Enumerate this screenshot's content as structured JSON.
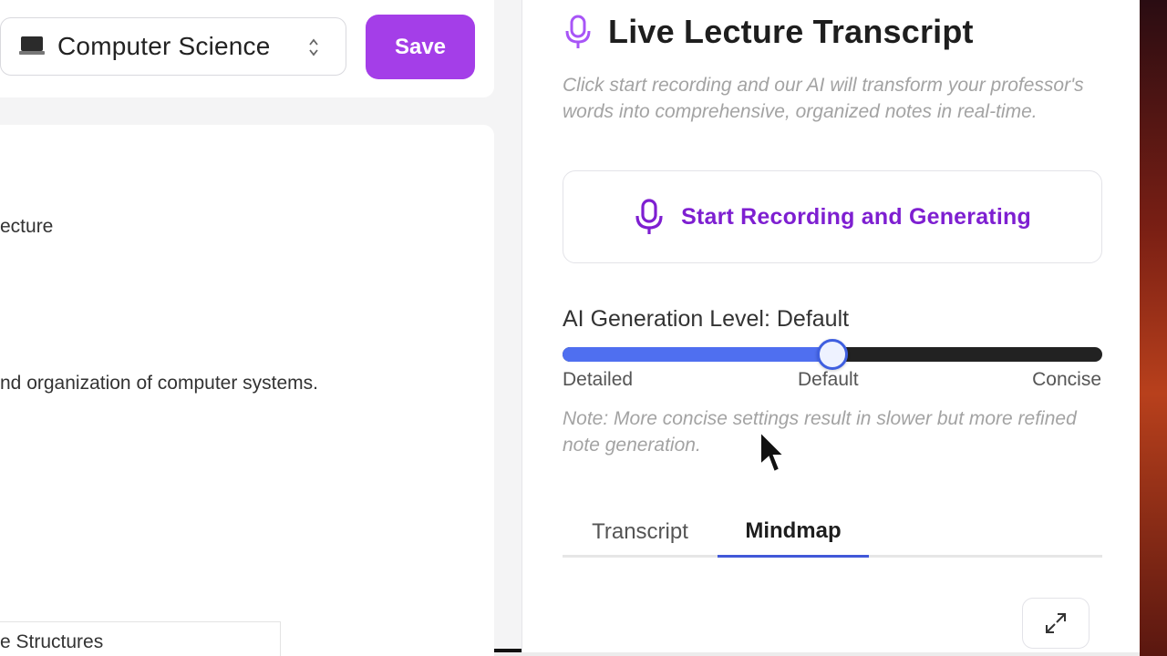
{
  "left": {
    "subject_select": {
      "value": "Computer Science",
      "icon": "laptop-icon"
    },
    "save_label": "Save",
    "content": {
      "line1": "ecture",
      "line2": "nd organization of computer systems.",
      "bottom_item": "e Structures"
    }
  },
  "right": {
    "title": "Live Lecture Transcript",
    "description": "Click start recording and our AI will transform your professor's words into comprehensive, organized notes in real-time.",
    "record_button_label": "Start Recording and Generating",
    "level_label": "AI Generation Level: Default",
    "slider": {
      "value_fraction": 0.5,
      "ticks": [
        "Detailed",
        "Default",
        "Concise"
      ]
    },
    "note": "Note: More concise settings result in slower but more refined note generation.",
    "tabs": [
      {
        "label": "Transcript",
        "active": false
      },
      {
        "label": "Mindmap",
        "active": true
      }
    ],
    "expand_icon": "expand-icon"
  },
  "colors": {
    "accent_purple": "#a43ee8",
    "record_text": "#7e1fd1",
    "slider_fill": "#4f6ff0",
    "tab_underline": "#4158d8"
  }
}
